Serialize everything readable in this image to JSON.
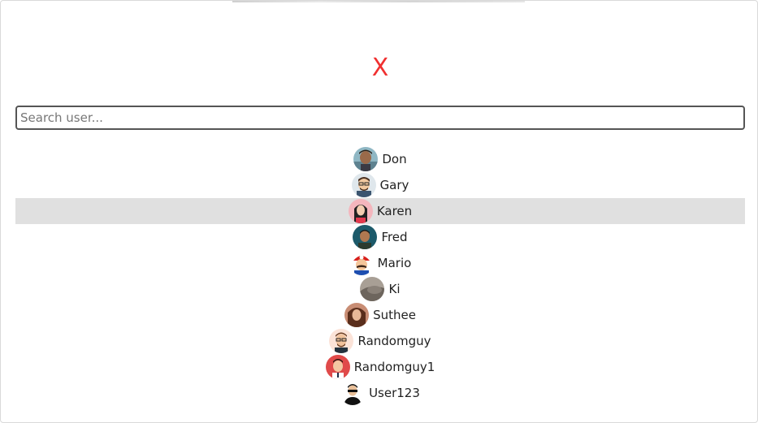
{
  "dialog": {
    "close_label": "X",
    "close_color": "#f03030",
    "search_placeholder": "Search user...",
    "search_value": ""
  },
  "users": [
    {
      "name": "Don",
      "avatar": "don-avatar-icon",
      "selected": false
    },
    {
      "name": "Gary",
      "avatar": "gary-avatar-icon",
      "selected": false
    },
    {
      "name": "Karen",
      "avatar": "karen-avatar-icon",
      "selected": true
    },
    {
      "name": "Fred",
      "avatar": "fred-avatar-icon",
      "selected": false
    },
    {
      "name": "Mario",
      "avatar": "mario-avatar-icon",
      "selected": false
    },
    {
      "name": "Ki",
      "avatar": "ki-avatar-icon",
      "selected": false
    },
    {
      "name": "Suthee",
      "avatar": "suthee-avatar-icon",
      "selected": false
    },
    {
      "name": "Randomguy",
      "avatar": "randomguy-avatar-icon",
      "selected": false
    },
    {
      "name": "Randomguy1",
      "avatar": "randomguy1-avatar-icon",
      "selected": false
    },
    {
      "name": "User123",
      "avatar": "user123-avatar-icon",
      "selected": false
    }
  ],
  "selection_color": "#e0e0e0"
}
